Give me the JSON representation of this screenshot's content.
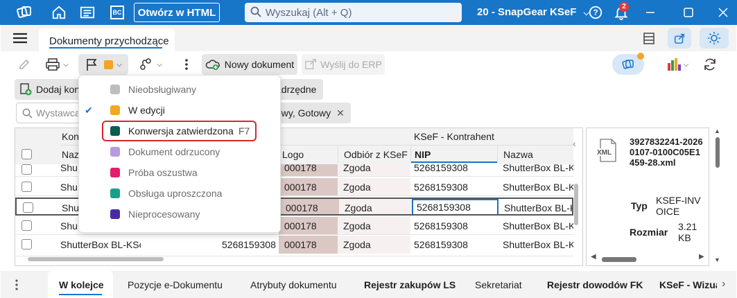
{
  "titlebar": {
    "html_button": "Otwórz w HTML",
    "search_placeholder": "Wyszukaj (Alt + Q)",
    "app_title": "20 - SnapGear KSeF",
    "notifications_count": "2",
    "bc_label": "BC"
  },
  "tabs": {
    "active": "Dokumenty przychodzące"
  },
  "toolbar": {
    "new_document": "Nowy dokument",
    "send_erp": "Wyślij do ERP",
    "add_con": "Dodaj kon",
    "parent_suffix": "adrzędne"
  },
  "filter": {
    "search_placeholder": "Wystawca",
    "chip_text": "owy, Gotowy"
  },
  "grid": {
    "group_header_1": "Kon",
    "group_header_2": "KSeF - Kontrahent",
    "columns": [
      "Naz",
      "Logo",
      "Odbiór z KSeF",
      "NIP",
      "Nazwa"
    ],
    "rows": [
      {
        "name": "Shu",
        "nip1": "",
        "logo": "000178",
        "odbior": "Zgoda",
        "nip": "5268159308",
        "nazwa": "ShutterBox BL-KSef"
      },
      {
        "name": "Shu",
        "nip1": "",
        "logo": "000178",
        "odbior": "Zgoda",
        "nip": "5268159308",
        "nazwa": "ShutterBox BL-KSef"
      },
      {
        "name": "Shu",
        "nip1": "",
        "logo": "000178",
        "odbior": "Zgoda",
        "nip": "5268159308",
        "nazwa": "ShutterBox BL-KSef"
      },
      {
        "name": "Shu",
        "nip1": "",
        "logo": "000178",
        "odbior": "Zgoda",
        "nip": "5268159308",
        "nazwa": "ShutterBox BL-KSef"
      },
      {
        "name": "ShutterBox BL-KSef",
        "nip1": "5268159308",
        "logo": "000178",
        "odbior": "Zgoda",
        "nip": "5268159308",
        "nazwa": "ShutterBox BL-KSef"
      }
    ]
  },
  "side_panel": {
    "file_badge": "XML",
    "filename": "3927832241-20260107-0100C05E1459-28.xml",
    "type_label": "Typ",
    "type_value": "KSEF-INVOICE",
    "size_label": "Rozmiar",
    "size_value": "3.21 KB"
  },
  "status_menu": {
    "items": [
      {
        "label": "Nieobsługiwany",
        "color": "#bdbdbd",
        "checked": false,
        "key": ""
      },
      {
        "label": "W edycji",
        "color": "#f4a623",
        "checked": true,
        "key": ""
      },
      {
        "label": "Konwersja zatwierdzona",
        "color": "#0b5e4e",
        "checked": false,
        "key": "F7"
      },
      {
        "label": "Dokument odrzucony",
        "color": "#b79ae0",
        "checked": false,
        "key": ""
      },
      {
        "label": "Próba oszustwa",
        "color": "#e0206a",
        "checked": false,
        "key": ""
      },
      {
        "label": "Obsługa uproszczona",
        "color": "#1a9e8a",
        "checked": false,
        "key": ""
      },
      {
        "label": "Nieprocesowany",
        "color": "#4b2aa6",
        "checked": false,
        "key": ""
      }
    ]
  },
  "bottom_tabs": [
    "W kolejce",
    "Pozycje e-Dokumentu",
    "Atrybuty dokumentu",
    "Rejestr zakupów LS",
    "Sekretariat",
    "Rejestr dowodów FK",
    "KSeF - Wizua"
  ]
}
